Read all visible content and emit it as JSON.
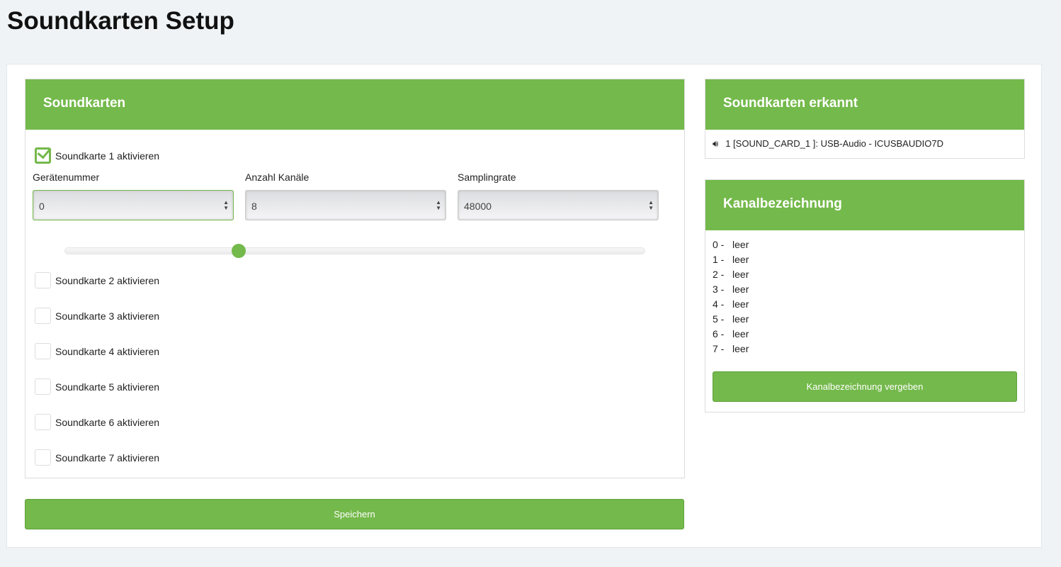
{
  "title": "Soundkarten Setup",
  "soundcards": {
    "header": "Soundkarten",
    "cards": [
      {
        "label": "Soundkarte 1 aktivieren",
        "checked": true
      },
      {
        "label": "Soundkarte 2 aktivieren",
        "checked": false
      },
      {
        "label": "Soundkarte 3 aktivieren",
        "checked": false
      },
      {
        "label": "Soundkarte 4 aktivieren",
        "checked": false
      },
      {
        "label": "Soundkarte 5 aktivieren",
        "checked": false
      },
      {
        "label": "Soundkarte 6 aktivieren",
        "checked": false
      },
      {
        "label": "Soundkarte 7 aktivieren",
        "checked": false
      }
    ],
    "fields": [
      {
        "label": "Gerätenummer",
        "value": "0"
      },
      {
        "label": "Anzahl Kanäle",
        "value": "8"
      },
      {
        "label": "Samplingrate",
        "value": "48000"
      }
    ],
    "slider_fraction": 0.3,
    "save": "Speichern"
  },
  "detected": {
    "header": "Soundkarten erkannt",
    "item": "1 [SOUND_CARD_1 ]: USB-Audio - ICUSBAUDIO7D"
  },
  "channels": {
    "header": "Kanalbezeichnung",
    "items": [
      {
        "num": "0 -",
        "name": "leer"
      },
      {
        "num": "1 -",
        "name": "leer"
      },
      {
        "num": "2 -",
        "name": "leer"
      },
      {
        "num": "3 -",
        "name": "leer"
      },
      {
        "num": "4 -",
        "name": "leer"
      },
      {
        "num": "5 -",
        "name": "leer"
      },
      {
        "num": "6 -",
        "name": "leer"
      },
      {
        "num": "7 -",
        "name": "leer"
      }
    ],
    "button": "Kanalbezeichnung vergeben"
  },
  "accent": "#74b94b"
}
